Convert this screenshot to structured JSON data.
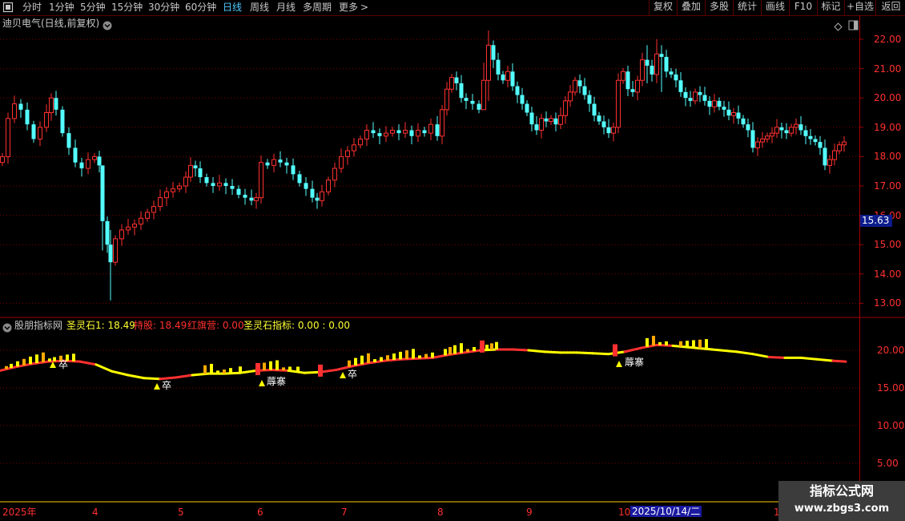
{
  "toolbar": {
    "periods": [
      {
        "label": "分时",
        "active": false
      },
      {
        "label": "1分钟",
        "active": false
      },
      {
        "label": "5分钟",
        "active": false
      },
      {
        "label": "15分钟",
        "active": false
      },
      {
        "label": "30分钟",
        "active": false
      },
      {
        "label": "60分钟",
        "active": false
      },
      {
        "label": "日线",
        "active": true
      },
      {
        "label": "周线",
        "active": false
      },
      {
        "label": "月线",
        "active": false
      },
      {
        "label": "多周期",
        "active": false
      },
      {
        "label": "更多",
        "active": false
      }
    ],
    "more_arrow": ">",
    "right_buttons": [
      "复权",
      "叠加",
      "多股",
      "统计",
      "画线",
      "F10",
      "标记",
      "+自选",
      "返回"
    ]
  },
  "main_chart": {
    "title": "迪贝电气(日线,前复权)",
    "price_axis": [
      "22.00",
      "21.00",
      "20.00",
      "19.00",
      "18.00",
      "17.00",
      "16.00",
      "15.00",
      "14.00",
      "13.00"
    ],
    "current_price_label": "15.63"
  },
  "indicator": {
    "name": "股朋指标网",
    "items": [
      {
        "label": "圣灵石1: 18.49",
        "color": "#ffff33"
      },
      {
        "label": "持股: 18.49",
        "color": "#ff3030"
      },
      {
        "label": "红旗营: 0.00",
        "color": "#ff3030"
      },
      {
        "label": "圣灵石指标: 0.00 : 0.00",
        "color": "#ffff33"
      }
    ],
    "axis": [
      "20.00",
      "15.00",
      "10.00",
      "5.00"
    ],
    "signals": [
      {
        "text": "卒",
        "pos": "x1"
      },
      {
        "text": "卒",
        "pos": "x2"
      },
      {
        "text": "蓐寨",
        "pos": "x3"
      },
      {
        "text": "卒",
        "pos": "x4"
      },
      {
        "text": "蓐寨",
        "pos": "x5"
      }
    ]
  },
  "time_axis": {
    "labels": [
      "2025年",
      "4",
      "5",
      "6",
      "7",
      "8",
      "9",
      "10",
      "1"
    ],
    "cursor_date": "2025/10/14/二"
  },
  "watermark": {
    "line1": "指标公式网",
    "line2": "www.zbgs3.com"
  },
  "colors": {
    "up": "#ff3030",
    "down": "#54ffff",
    "grid": "#7a0000",
    "axis_text": "#ff3030",
    "active": "#4fc8ff",
    "line_yellow": "#ffff00"
  }
}
